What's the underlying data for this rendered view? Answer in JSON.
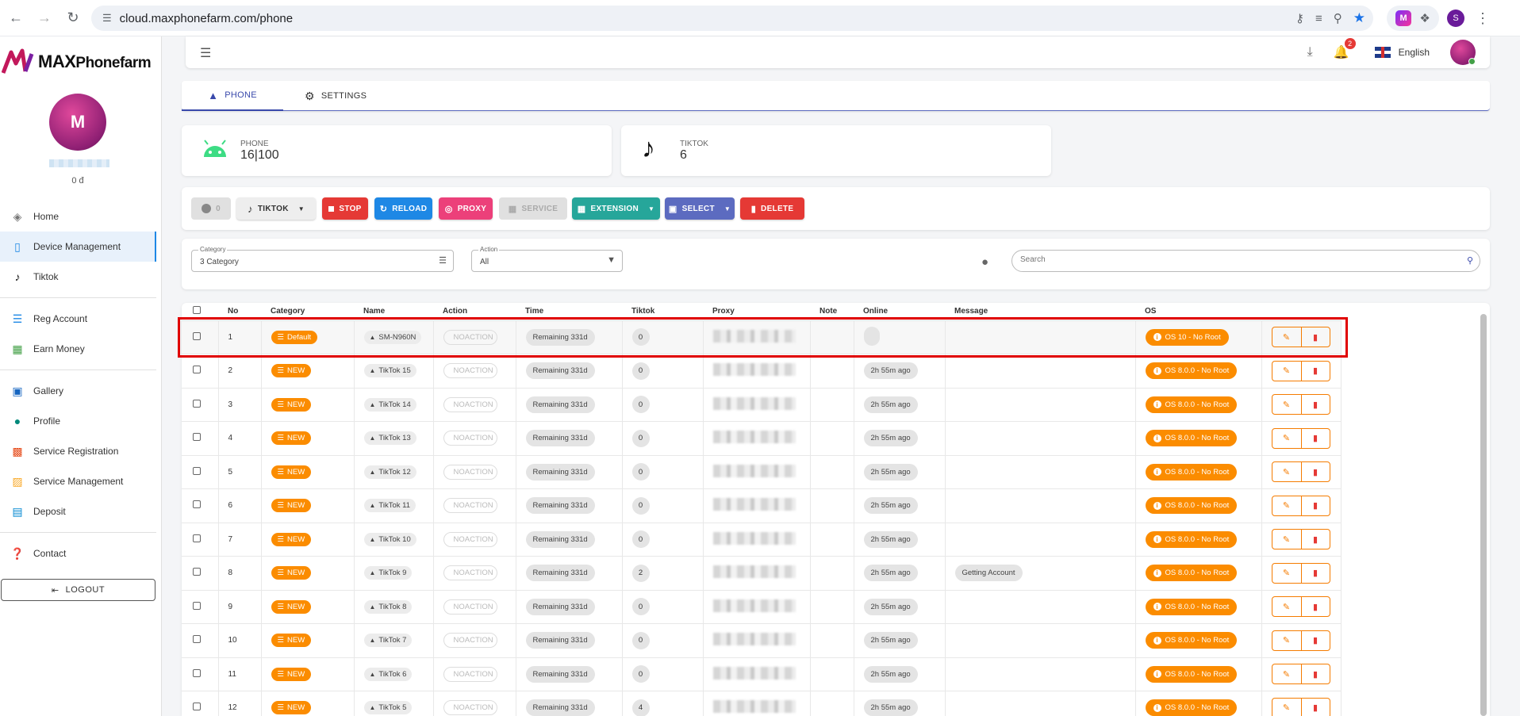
{
  "browser": {
    "url": "cloud.maxphonefarm.com/phone",
    "profile_initial": "S",
    "ext_logo_text": "M"
  },
  "sidebar": {
    "brand_bold": "MAX",
    "brand_rest": "Phonefarm",
    "avatar_text": "M",
    "balance": "0 đ",
    "items": [
      {
        "label": "Home",
        "icon": "layers-icon"
      },
      {
        "label": "Device Management",
        "icon": "device-icon",
        "active": true
      },
      {
        "label": "Tiktok",
        "icon": "tiktok-icon"
      },
      {
        "label": "Reg Account",
        "icon": "checklist-icon"
      },
      {
        "label": "Earn Money",
        "icon": "money-icon"
      },
      {
        "label": "Gallery",
        "icon": "image-icon"
      },
      {
        "label": "Profile",
        "icon": "person-icon"
      },
      {
        "label": "Service Registration",
        "icon": "grid-icon"
      },
      {
        "label": "Service Management",
        "icon": "manage-icon"
      },
      {
        "label": "Deposit",
        "icon": "wallet-icon"
      },
      {
        "label": "Contact",
        "icon": "help-icon"
      }
    ],
    "logout": "LOGOUT"
  },
  "topbar": {
    "notification_count": "2",
    "language": "English"
  },
  "tabs": {
    "phone": "PHONE",
    "settings": "SETTINGS"
  },
  "stats": {
    "phone_label": "PHONE",
    "phone_value": "16|100",
    "tiktok_label": "TIKTOK",
    "tiktok_value": "6"
  },
  "toolbar": {
    "toggle_count": "0",
    "platform": "TIKTOK",
    "stop": "STOP",
    "reload": "RELOAD",
    "proxy": "PROXY",
    "service": "SERVICE",
    "extension": "EXTENSION",
    "select": "SELECT",
    "delete": "DELETE"
  },
  "filters": {
    "category_label": "Category",
    "category_value": "3 Category",
    "action_label": "Action",
    "action_value": "All",
    "search_placeholder": "Search"
  },
  "table": {
    "headers": [
      "No",
      "Category",
      "Name",
      "Action",
      "Time",
      "Tiktok",
      "Proxy",
      "Note",
      "Online",
      "Message",
      "OS"
    ],
    "rows": [
      {
        "no": "1",
        "category": "Default",
        "name": "SM-N960N",
        "action": "NOACTION",
        "time": "Remaining 331d",
        "tiktok": "0",
        "online": "",
        "message": "",
        "os": "OS 10 - No Root"
      },
      {
        "no": "2",
        "category": "NEW",
        "name": "TikTok 15",
        "action": "NOACTION",
        "time": "Remaining 331d",
        "tiktok": "0",
        "online": "2h 55m ago",
        "message": "",
        "os": "OS 8.0.0 - No Root"
      },
      {
        "no": "3",
        "category": "NEW",
        "name": "TikTok 14",
        "action": "NOACTION",
        "time": "Remaining 331d",
        "tiktok": "0",
        "online": "2h 55m ago",
        "message": "",
        "os": "OS 8.0.0 - No Root"
      },
      {
        "no": "4",
        "category": "NEW",
        "name": "TikTok 13",
        "action": "NOACTION",
        "time": "Remaining 331d",
        "tiktok": "0",
        "online": "2h 55m ago",
        "message": "",
        "os": "OS 8.0.0 - No Root"
      },
      {
        "no": "5",
        "category": "NEW",
        "name": "TikTok 12",
        "action": "NOACTION",
        "time": "Remaining 331d",
        "tiktok": "0",
        "online": "2h 55m ago",
        "message": "",
        "os": "OS 8.0.0 - No Root"
      },
      {
        "no": "6",
        "category": "NEW",
        "name": "TikTok 11",
        "action": "NOACTION",
        "time": "Remaining 331d",
        "tiktok": "0",
        "online": "2h 55m ago",
        "message": "",
        "os": "OS 8.0.0 - No Root"
      },
      {
        "no": "7",
        "category": "NEW",
        "name": "TikTok 10",
        "action": "NOACTION",
        "time": "Remaining 331d",
        "tiktok": "0",
        "online": "2h 55m ago",
        "message": "",
        "os": "OS 8.0.0 - No Root"
      },
      {
        "no": "8",
        "category": "NEW",
        "name": "TikTok 9",
        "action": "NOACTION",
        "time": "Remaining 331d",
        "tiktok": "2",
        "online": "2h 55m ago",
        "message": "Getting Account",
        "os": "OS 8.0.0 - No Root"
      },
      {
        "no": "9",
        "category": "NEW",
        "name": "TikTok 8",
        "action": "NOACTION",
        "time": "Remaining 331d",
        "tiktok": "0",
        "online": "2h 55m ago",
        "message": "",
        "os": "OS 8.0.0 - No Root"
      },
      {
        "no": "10",
        "category": "NEW",
        "name": "TikTok 7",
        "action": "NOACTION",
        "time": "Remaining 331d",
        "tiktok": "0",
        "online": "2h 55m ago",
        "message": "",
        "os": "OS 8.0.0 - No Root"
      },
      {
        "no": "11",
        "category": "NEW",
        "name": "TikTok 6",
        "action": "NOACTION",
        "time": "Remaining 331d",
        "tiktok": "0",
        "online": "2h 55m ago",
        "message": "",
        "os": "OS 8.0.0 - No Root"
      },
      {
        "no": "12",
        "category": "NEW",
        "name": "TikTok 5",
        "action": "NOACTION",
        "time": "Remaining 331d",
        "tiktok": "4",
        "online": "2h 55m ago",
        "message": "",
        "os": "OS 8.0.0 - No Root"
      }
    ]
  },
  "colors": {
    "accent": "#3949ab",
    "orange": "#fb8c00",
    "stop": "#e53935",
    "reload": "#1e88e5",
    "proxy": "#ec407a",
    "extension": "#26a69a",
    "select": "#5c6bc0",
    "highlight": "#e00000"
  }
}
